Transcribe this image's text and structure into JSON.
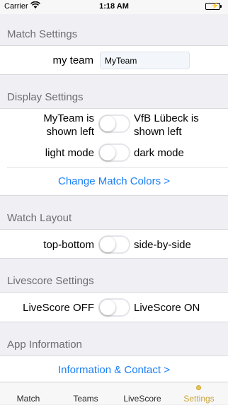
{
  "status": {
    "carrier": "Carrier",
    "time": "1:18 AM"
  },
  "sections": {
    "match": {
      "header": "Match Settings",
      "team_label": "my team",
      "team_value": "MyTeam"
    },
    "display": {
      "header": "Display Settings",
      "row1_left": "MyTeam is\nshown left",
      "row1_right": "VfB Lübeck is\nshown left",
      "row2_left": "light mode",
      "row2_right": "dark mode",
      "colors_link": "Change Match Colors >"
    },
    "watch": {
      "header": "Watch Layout",
      "left": "top-bottom",
      "right": "side-by-side"
    },
    "livescore": {
      "header": "Livescore Settings",
      "left": "LiveScore OFF",
      "right": "LiveScore ON"
    },
    "app": {
      "header": "App Information",
      "info_link": "Information & Contact  >"
    }
  },
  "tabs": [
    {
      "label": "Match"
    },
    {
      "label": "Teams"
    },
    {
      "label": "LiveScore"
    },
    {
      "label": "Settings"
    }
  ],
  "colors": {
    "accent": "#1a7ff5",
    "tab_active": "#c9a43a",
    "battery": "#4cd964"
  }
}
